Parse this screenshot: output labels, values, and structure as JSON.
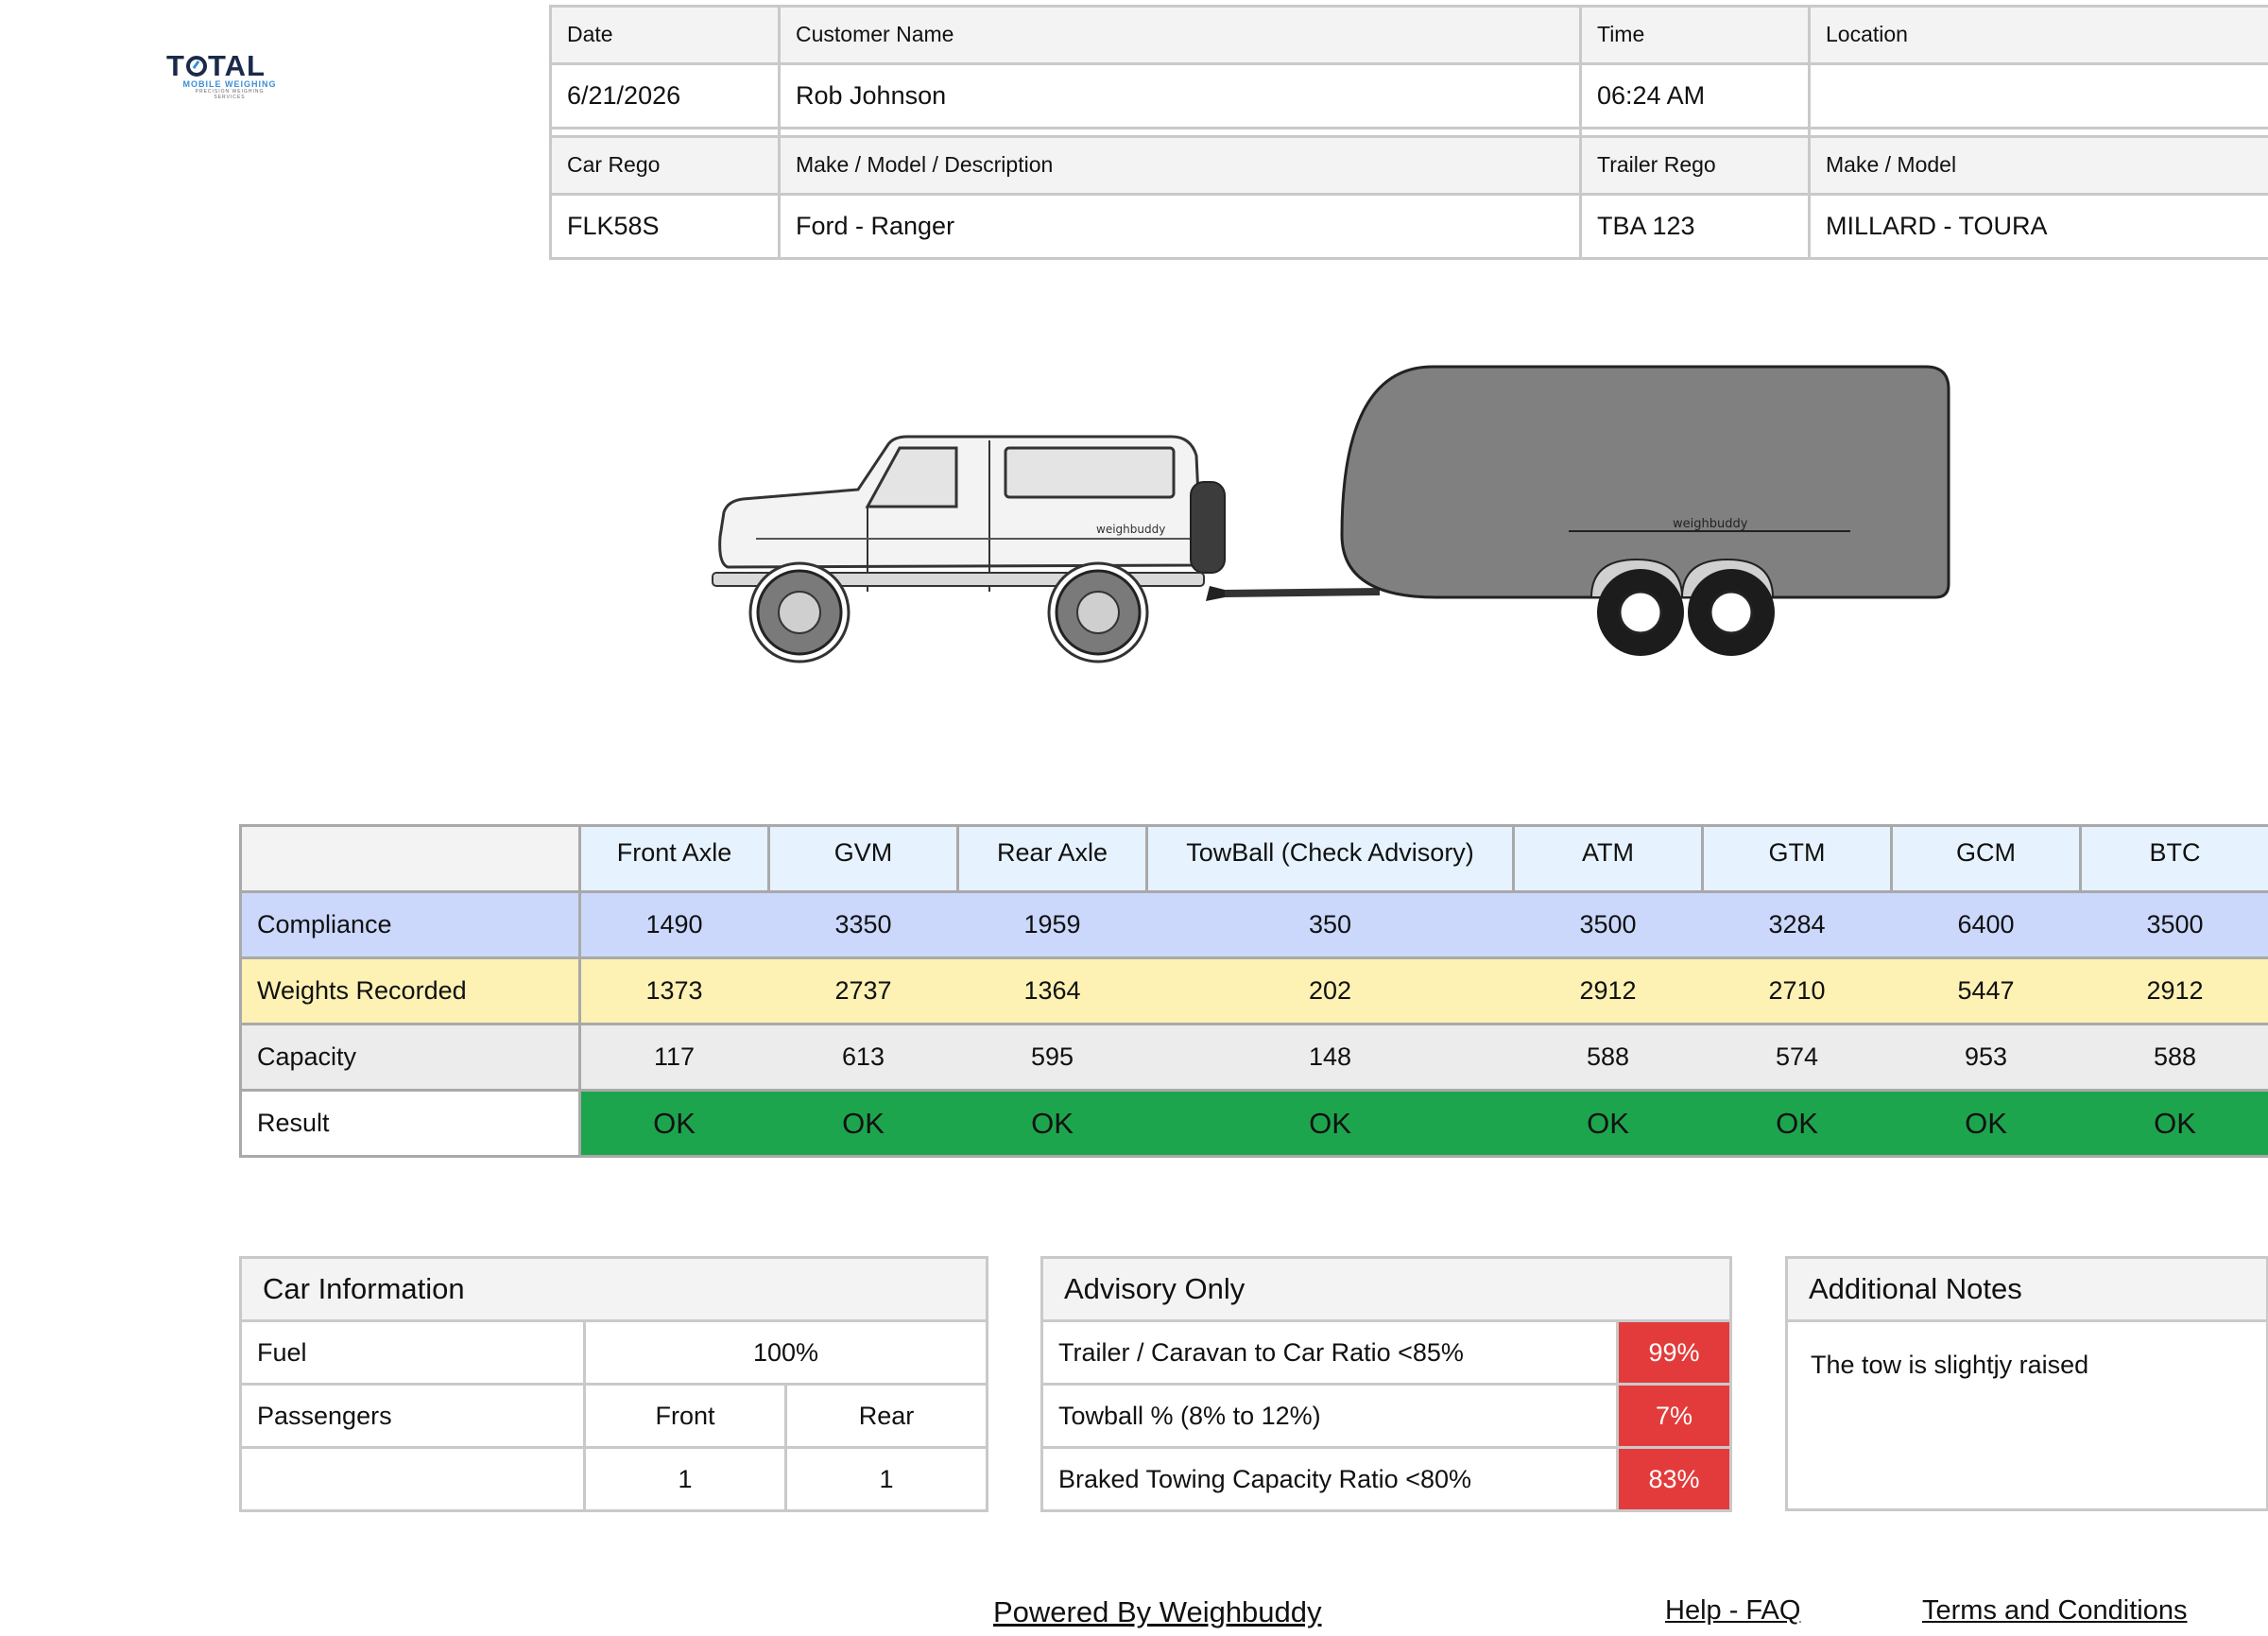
{
  "logo": {
    "brand_left": "T",
    "brand_right": "TAL",
    "tagline": "MOBILE WEIGHING",
    "subtagline": "PRECISION WEIGHING SERVICES"
  },
  "header": {
    "labels_row1": [
      "Date",
      "Customer Name",
      "Time",
      "Location"
    ],
    "values_row1": [
      "6/21/2026",
      "Rob Johnson",
      "06:24 AM",
      ""
    ],
    "labels_row2": [
      "Car Rego",
      "Make / Model / Description",
      "Trailer Rego",
      "Make / Model"
    ],
    "values_row2": [
      "FLK58S",
      "Ford - Ranger",
      "TBA 123",
      "MILLARD - TOURA"
    ]
  },
  "illustration": {
    "car_brand": "weighbuddy",
    "trailer_brand": "weighbuddy",
    "car_color": "#f3f3f3",
    "trailer_color": "#808080"
  },
  "compliance": {
    "columns": [
      "Front Axle",
      "GVM",
      "Rear Axle",
      "TowBall (Check Advisory)",
      "ATM",
      "GTM",
      "GCM",
      "BTC"
    ],
    "rows": [
      {
        "label": "Compliance",
        "values": [
          "1490",
          "3350",
          "1959",
          "350",
          "3500",
          "3284",
          "6400",
          "3500"
        ]
      },
      {
        "label": "Weights Recorded",
        "values": [
          "1373",
          "2737",
          "1364",
          "202",
          "2912",
          "2710",
          "5447",
          "2912"
        ]
      },
      {
        "label": "Capacity",
        "values": [
          "117",
          "613",
          "595",
          "148",
          "588",
          "574",
          "953",
          "588"
        ]
      },
      {
        "label": "Result",
        "values": [
          "OK",
          "OK",
          "OK",
          "OK",
          "OK",
          "OK",
          "OK",
          "OK"
        ]
      }
    ],
    "colors": {
      "header": "#e6f2fd",
      "compliance": "#cbd8fc",
      "recorded": "#fdf1b4",
      "capacity": "#ececec",
      "ok": "#1da54e"
    }
  },
  "car_info": {
    "title": "Car Information",
    "fuel_label": "Fuel",
    "fuel_value": "100%",
    "passengers_label": "Passengers",
    "front_label": "Front",
    "rear_label": "Rear",
    "front_value": "1",
    "rear_value": "1"
  },
  "advisory": {
    "title": "Advisory Only",
    "items": [
      {
        "label": "Trailer / Caravan to Car Ratio <85%",
        "value": "99%"
      },
      {
        "label": "Towball % (8% to 12%)",
        "value": "7%"
      },
      {
        "label": "Braked Towing Capacity Ratio <80%",
        "value": "83%"
      }
    ],
    "alert_color": "#e33b3b"
  },
  "notes": {
    "title": "Additional Notes",
    "text": "The tow is slightjy raised"
  },
  "footer": {
    "powered": "Powered By Weighbuddy",
    "help": "Help - FAQ",
    "terms": "Terms and Conditions"
  }
}
